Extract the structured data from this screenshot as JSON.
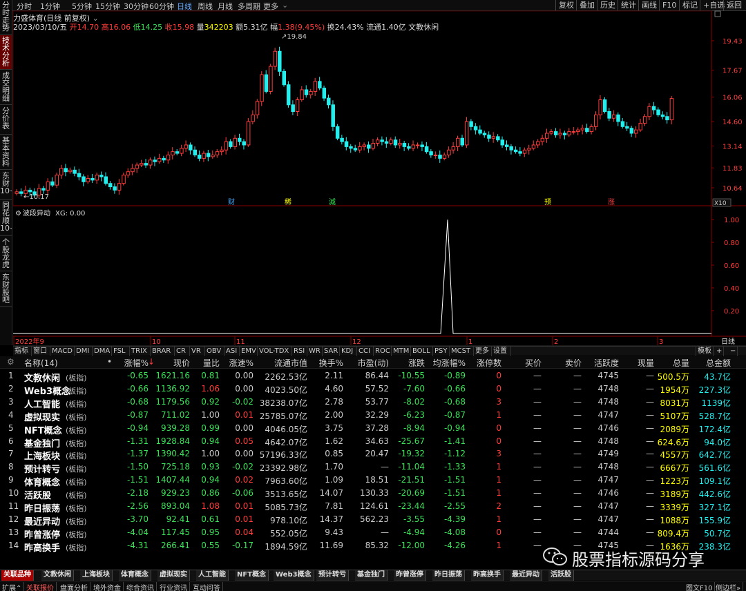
{
  "topbar": {
    "periods": [
      "分时",
      "1分钟",
      "5分钟",
      "15分钟",
      "30分钟",
      "60分钟",
      "日线",
      "周线",
      "月线",
      "多周期",
      "更多"
    ],
    "active_period": "日线",
    "right_buttons": [
      "复权",
      "叠加",
      "历史",
      "统计",
      "画线",
      "F10",
      "标记",
      "+自选",
      "返回"
    ]
  },
  "left_tabs": [
    "分时走势",
    "技术分析",
    "成交明细",
    "分价表",
    "基本资料",
    "东财10+",
    "同花顺10+",
    "个股龙虎",
    "东财股吧"
  ],
  "chart": {
    "stock_title": "力盛体育(日线 前复权)",
    "date": "2023/03/10/五",
    "open_label": "开",
    "open": "14.70",
    "high_label": "高",
    "high": "16.06",
    "low_label": "低",
    "low": "14.25",
    "close_label": "收",
    "close": "15.98",
    "volume_label": "量",
    "volume": "342203",
    "amount_label": "额",
    "amount": "5.31亿",
    "range_label": "幅",
    "range": "1.38(9.45%)",
    "turnover": "换24.43%",
    "float_cap": "流通1.40亿",
    "sector": "文教休闲",
    "price_axis": [
      "19.43",
      "17.67",
      "16.06",
      "14.60",
      "13.14",
      "11.83",
      "10.64"
    ],
    "max_label": "19.84",
    "min_label": "10.17",
    "zoom_label": "X10",
    "event_markers": [
      "财",
      "稀",
      "減",
      "预",
      "涨"
    ]
  },
  "indicator": {
    "name": "波段异动",
    "param": "XG: 0.00",
    "axis": [
      "1.00",
      "0.80",
      "0.60",
      "0.40",
      "0.20"
    ],
    "spike_value": 1.0
  },
  "time_axis": {
    "labels": [
      "2022年9",
      "10",
      "11",
      "12",
      "1",
      "2",
      "3"
    ],
    "period": "日线"
  },
  "indicator_tabs": [
    "指标",
    "窗口",
    "MACD",
    "DMI",
    "DMA",
    "FSL",
    "TRIX",
    "BRAR",
    "CR",
    "VR",
    "OBV",
    "ASI",
    "EMV",
    "VOL-TDX",
    "RSI",
    "WR",
    "SAR",
    "KDJ",
    "CCI",
    "ROC",
    "MTM",
    "BOLL",
    "PSY",
    "MCST",
    "更多",
    "设置"
  ],
  "template_label": "模板",
  "table": {
    "headers": [
      "名称(14)",
      "涨幅%",
      "现价",
      "量比",
      "涨速%",
      "流通市值",
      "换手%",
      "市盈(动)",
      "涨跌",
      "均涨幅%",
      "涨停数",
      "买价",
      "卖价",
      "活跃度",
      "现量",
      "总量",
      "总金额"
    ],
    "sort_mark": "↓",
    "rows": [
      {
        "n": "1",
        "name": "文教休闲",
        "tag": "(板指)",
        "chg": "-0.65",
        "price": "1621.16",
        "vr": "0.81",
        "spd": "0.00",
        "fmv": "2262.53亿",
        "to": "2.11",
        "pe": "86.44",
        "up": "-10.55",
        "avg": "-0.89",
        "lim": "0",
        "buy": "—",
        "sell": "—",
        "act": "4745",
        "cur": "—",
        "vol": "500.5万",
        "amt": "43.7亿"
      },
      {
        "n": "2",
        "name": "Web3概念",
        "tag": "(板指)",
        "chg": "-0.66",
        "price": "1136.92",
        "vr": "1.06",
        "spd": "0.00",
        "fmv": "4023.50亿",
        "to": "4.60",
        "pe": "57.52",
        "up": "-7.60",
        "avg": "-0.66",
        "lim": "0",
        "buy": "—",
        "sell": "—",
        "act": "4748",
        "cur": "—",
        "vol": "1954万",
        "amt": "227.3亿"
      },
      {
        "n": "3",
        "name": "人工智能",
        "tag": "(板指)",
        "chg": "-0.68",
        "price": "1179.56",
        "vr": "0.92",
        "spd": "-0.02",
        "fmv": "38238.07亿",
        "to": "2.78",
        "pe": "53.77",
        "up": "-8.02",
        "avg": "-0.68",
        "lim": "3",
        "buy": "—",
        "sell": "—",
        "act": "4748",
        "cur": "—",
        "vol": "8031万",
        "amt": "1139亿"
      },
      {
        "n": "4",
        "name": "虚拟现实",
        "tag": "(板指)",
        "chg": "-0.87",
        "price": "711.02",
        "vr": "1.00",
        "spd": "0.01",
        "fmv": "25785.07亿",
        "to": "2.00",
        "pe": "32.29",
        "up": "-6.23",
        "avg": "-0.87",
        "lim": "1",
        "buy": "—",
        "sell": "—",
        "act": "4747",
        "cur": "—",
        "vol": "5107万",
        "amt": "528.7亿"
      },
      {
        "n": "5",
        "name": "NFT概念",
        "tag": "(板指)",
        "chg": "-0.94",
        "price": "939.28",
        "vr": "0.99",
        "spd": "0.00",
        "fmv": "4046.05亿",
        "to": "3.75",
        "pe": "37.28",
        "up": "-8.94",
        "avg": "-0.94",
        "lim": "0",
        "buy": "—",
        "sell": "—",
        "act": "4746",
        "cur": "—",
        "vol": "2089万",
        "amt": "172.4亿"
      },
      {
        "n": "6",
        "name": "基金独门",
        "tag": "(板指)",
        "chg": "-1.31",
        "price": "1928.84",
        "vr": "0.94",
        "spd": "0.05",
        "fmv": "4642.07亿",
        "to": "1.62",
        "pe": "34.63",
        "up": "-25.67",
        "avg": "-1.41",
        "lim": "0",
        "buy": "—",
        "sell": "—",
        "act": "4748",
        "cur": "—",
        "vol": "624.6万",
        "amt": "94.0亿"
      },
      {
        "n": "7",
        "name": "上海板块",
        "tag": "(板指)",
        "chg": "-1.37",
        "price": "1390.42",
        "vr": "1.00",
        "spd": "0.00",
        "fmv": "57196.33亿",
        "to": "0.85",
        "pe": "20.47",
        "up": "-19.32",
        "avg": "-1.12",
        "lim": "3",
        "buy": "—",
        "sell": "—",
        "act": "4749",
        "cur": "—",
        "vol": "4557万",
        "amt": "642.7亿"
      },
      {
        "n": "8",
        "name": "预计转亏",
        "tag": "(板指)",
        "chg": "-1.50",
        "price": "725.18",
        "vr": "0.93",
        "spd": "-0.02",
        "fmv": "23392.98亿",
        "to": "1.70",
        "pe": "—",
        "up": "-11.04",
        "avg": "-1.33",
        "lim": "1",
        "buy": "—",
        "sell": "—",
        "act": "4748",
        "cur": "—",
        "vol": "6667万",
        "amt": "561.6亿"
      },
      {
        "n": "9",
        "name": "体育概念",
        "tag": "(板指)",
        "chg": "-1.51",
        "price": "1407.44",
        "vr": "0.94",
        "spd": "0.02",
        "fmv": "7963.60亿",
        "to": "1.09",
        "pe": "18.51",
        "up": "-21.51",
        "avg": "-1.51",
        "lim": "1",
        "buy": "—",
        "sell": "—",
        "act": "4747",
        "cur": "—",
        "vol": "1223万",
        "amt": "109.1亿"
      },
      {
        "n": "10",
        "name": "活跃股",
        "tag": "(板指)",
        "chg": "-2.18",
        "price": "929.23",
        "vr": "0.86",
        "spd": "-0.06",
        "fmv": "3513.65亿",
        "to": "14.07",
        "pe": "130.33",
        "up": "-20.69",
        "avg": "-1.51",
        "lim": "1",
        "buy": "—",
        "sell": "—",
        "act": "4746",
        "cur": "—",
        "vol": "3189万",
        "amt": "442.6亿"
      },
      {
        "n": "11",
        "name": "昨日振荡",
        "tag": "(板指)",
        "chg": "-2.56",
        "price": "893.04",
        "vr": "1.08",
        "spd": "0.01",
        "fmv": "5085.73亿",
        "to": "7.81",
        "pe": "124.61",
        "up": "-23.44",
        "avg": "-2.55",
        "lim": "2",
        "buy": "—",
        "sell": "—",
        "act": "4747",
        "cur": "—",
        "vol": "3339万",
        "amt": "327.1亿"
      },
      {
        "n": "12",
        "name": "最近异动",
        "tag": "(板指)",
        "chg": "-3.70",
        "price": "92.41",
        "vr": "0.61",
        "spd": "0.01",
        "fmv": "978.10亿",
        "to": "14.37",
        "pe": "562.23",
        "up": "-3.55",
        "avg": "-4.39",
        "lim": "1",
        "buy": "—",
        "sell": "—",
        "act": "4747",
        "cur": "—",
        "vol": "1088万",
        "amt": "155.9亿"
      },
      {
        "n": "13",
        "name": "昨曾涨停",
        "tag": "(板指)",
        "chg": "-4.04",
        "price": "117.45",
        "vr": "0.95",
        "spd": "0.04",
        "fmv": "552.05亿",
        "to": "9.43",
        "pe": "—",
        "up": "-4.94",
        "avg": "-4.08",
        "lim": "0",
        "buy": "—",
        "sell": "—",
        "act": "4744",
        "cur": "—",
        "vol": "809.4万",
        "amt": "50.7亿"
      },
      {
        "n": "14",
        "name": "昨高换手",
        "tag": "(板指)",
        "chg": "-4.31",
        "price": "266.41",
        "vr": "0.55",
        "spd": "-0.17",
        "fmv": "1894.59亿",
        "to": "11.69",
        "pe": "85.32",
        "up": "-12.00",
        "avg": "-4.26",
        "lim": "1",
        "buy": "—",
        "sell": "—",
        "act": "4745",
        "cur": "—",
        "vol": "1636万",
        "amt": "238.3亿"
      }
    ]
  },
  "bottom_tabs": [
    "关联品种",
    "文教休闲",
    "上海板块",
    "体育概念",
    "虚拟现实",
    "人工智能",
    "NFT概念",
    "Web3概念",
    "预计转亏",
    "基金独门",
    "昨曾涨停",
    "昨日振荡",
    "昨高换手",
    "最近异动",
    "活跃股"
  ],
  "status_bar": [
    "扩展",
    "关联报价",
    "盘面分析",
    "境外资金",
    "综合资讯",
    "行业资讯",
    "互动问答"
  ],
  "status_right": [
    "图文F10",
    "侧边栏"
  ],
  "watermark": "股票指标源码分享",
  "colors": {
    "up": "#ff3c3c",
    "down": "#3ce05a",
    "candle_down": "#2ee",
    "bg": "#000"
  }
}
